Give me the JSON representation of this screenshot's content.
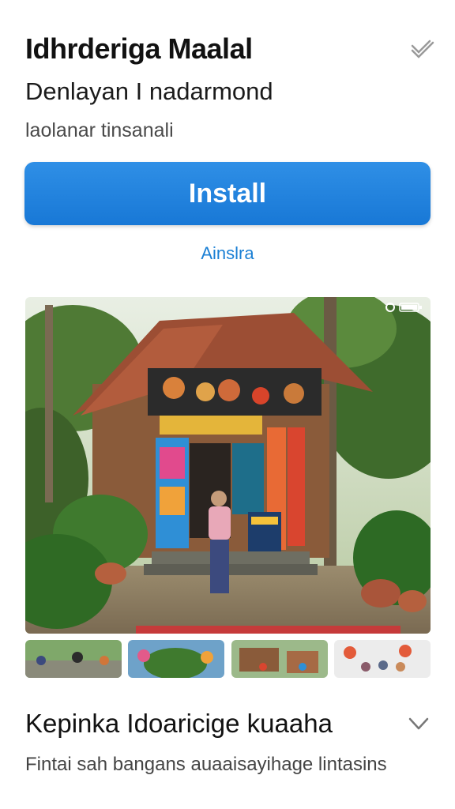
{
  "app": {
    "title": "Idhrderiga Maalal",
    "developer": "Denlayan I nadarmond",
    "tagline": "laolanar tinsanali"
  },
  "actions": {
    "install_label": "Install",
    "secondary_label": "Ainslra"
  },
  "icons": {
    "header_action": "checkmark-icon",
    "section_toggle": "chevron-down-icon"
  },
  "colors": {
    "accent": "#1f82db",
    "link": "#1a7fd4"
  },
  "screenshots": {
    "count": 5
  },
  "section": {
    "title": "Kepinka Idoaricige kuaaha",
    "description": "Fintai sah bangans auaaisayihage lintasins"
  }
}
